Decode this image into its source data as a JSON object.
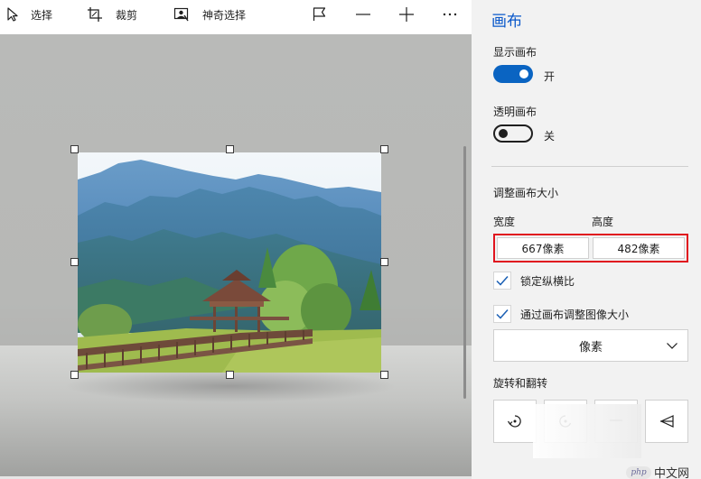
{
  "toolbar": {
    "select_label": "选择",
    "crop_label": "裁剪",
    "magic_select_label": "神奇选择",
    "icons": [
      "cursor-icon",
      "crop-icon",
      "magic-select-icon",
      "flag-icon",
      "minus-icon",
      "plus-icon",
      "more-icon"
    ]
  },
  "panel": {
    "title": "画布",
    "show_canvas_label": "显示画布",
    "show_canvas_state": "开",
    "show_canvas_on": true,
    "transparent_canvas_label": "透明画布",
    "transparent_canvas_state": "关",
    "transparent_canvas_on": false,
    "resize_title": "调整画布大小",
    "width_label": "宽度",
    "height_label": "高度",
    "width_value": "667像素",
    "height_value": "482像素",
    "lock_aspect_label": "锁定纵横比",
    "lock_aspect_checked": true,
    "resize_image_label": "通过画布调整图像大小",
    "resize_image_checked": true,
    "unit_value": "像素",
    "rotate_flip_title": "旋转和翻转"
  },
  "watermark": {
    "logo": "php",
    "text": "中文网"
  },
  "colors": {
    "accent": "#0a64c2",
    "title_blue": "#0a58ca",
    "highlight_red": "#e0141e"
  }
}
